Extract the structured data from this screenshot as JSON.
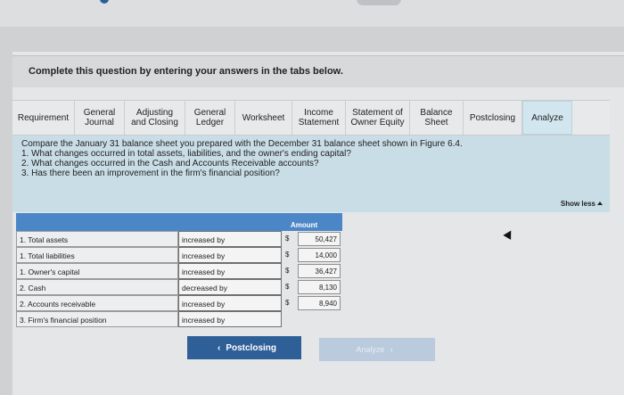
{
  "header": {
    "question_title": "Complete this question by entering your answers in the tabs below."
  },
  "tabs": [
    {
      "label": "Requirement"
    },
    {
      "label": "General Journal"
    },
    {
      "label": "Adjusting and Closing"
    },
    {
      "label": "General Ledger"
    },
    {
      "label": "Worksheet"
    },
    {
      "label": "Income Statement"
    },
    {
      "label": "Statement of Owner Equity"
    },
    {
      "label": "Balance Sheet"
    },
    {
      "label": "Postclosing"
    },
    {
      "label": "Analyze"
    }
  ],
  "instructions": {
    "lead": "Compare the January 31 balance sheet you prepared with the December 31 balance sheet shown in Figure 6.4.",
    "q1": "1. What changes occurred in total assets, liabilities, and the owner's ending capital?",
    "q2": "2. What changes occurred in the Cash and Accounts Receivable accounts?",
    "q3": "3. Has there been an improvement in the firm's financial position?",
    "show_less": "Show less"
  },
  "table": {
    "amount_header": "Amount",
    "rows": [
      {
        "label": "1. Total assets",
        "change": "increased by",
        "dollar": "$",
        "amount": "50,427"
      },
      {
        "label": "1. Total liabilities",
        "change": "increased by",
        "dollar": "$",
        "amount": "14,000"
      },
      {
        "label": "1. Owner's capital",
        "change": "increased by",
        "dollar": "$",
        "amount": "36,427"
      },
      {
        "label": "2. Cash",
        "change": "decreased by",
        "dollar": "$",
        "amount": "8,130"
      },
      {
        "label": "2. Accounts receivable",
        "change": "increased by",
        "dollar": "$",
        "amount": "8,940"
      },
      {
        "label": "3. Firm's financial position",
        "change": "increased by",
        "dollar": "",
        "amount": ""
      }
    ]
  },
  "nav": {
    "prev_label": "Postclosing",
    "next_label": "Analyze"
  },
  "colors": {
    "accent": "#2f5f97",
    "table_header": "#4b86c7",
    "content_bg": "#c9dde6"
  }
}
